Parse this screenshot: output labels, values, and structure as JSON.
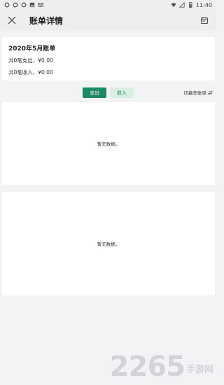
{
  "status_bar": {
    "time": "11:40",
    "left_icons": [
      "notification-icon",
      "notification-icon",
      "notification-icon",
      "image-icon",
      "mail-icon"
    ],
    "right_icons": [
      "wifi-icon",
      "signal-icon",
      "battery-icon"
    ]
  },
  "app_bar": {
    "title": "账单详情",
    "close_icon": "close-icon",
    "calendar_icon": "calendar-icon"
  },
  "summary": {
    "title": "2020年5月账单",
    "expense_line": "共0笔支出，¥0.00",
    "income_line": "共0笔收入，¥0.00"
  },
  "tabs": {
    "expense_label": "支出",
    "income_label": "收入",
    "selected": "expense"
  },
  "switch": {
    "label": "切换年账单",
    "icon": "swap-icon"
  },
  "panels": {
    "top_empty": "暂无数据。",
    "bottom_empty": "暂无数据。"
  },
  "watermark": {
    "number": "2265",
    "text": "手游网"
  },
  "colors": {
    "accent": "#1b8a63",
    "accent_light": "#d9efe4",
    "background": "#f2f3f5"
  }
}
